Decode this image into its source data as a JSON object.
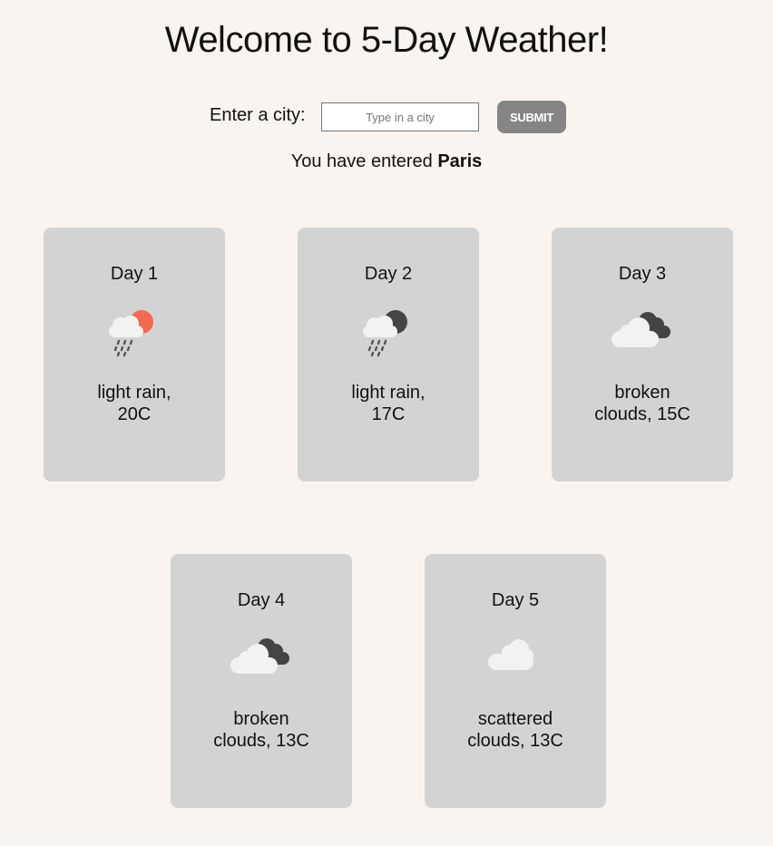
{
  "header": {
    "title": "Welcome to 5-Day Weather!"
  },
  "search": {
    "label": "Enter a city:",
    "placeholder": "Type in a city",
    "value": "",
    "submit_label": "SUBMIT"
  },
  "status": {
    "prefix": "You have entered ",
    "city": "Paris"
  },
  "colors": {
    "background": "#f9f4f0",
    "card": "#d3d3d3",
    "button": "#858585",
    "sun": "#f26a4f",
    "moon": "#444444",
    "cloud_light": "#f2f2f2"
  },
  "days": [
    {
      "label": "Day 1",
      "icon": "light-rain-day-icon",
      "desc_line1": "light rain,",
      "desc_line2": "20C"
    },
    {
      "label": "Day 2",
      "icon": "light-rain-night-icon",
      "desc_line1": "light rain,",
      "desc_line2": "17C"
    },
    {
      "label": "Day 3",
      "icon": "broken-clouds-icon",
      "desc_line1": "broken",
      "desc_line2": "clouds, 15C"
    },
    {
      "label": "Day 4",
      "icon": "broken-clouds-icon",
      "desc_line1": "broken",
      "desc_line2": "clouds, 13C"
    },
    {
      "label": "Day 5",
      "icon": "scattered-clouds-icon",
      "desc_line1": "scattered",
      "desc_line2": "clouds, 13C"
    }
  ]
}
